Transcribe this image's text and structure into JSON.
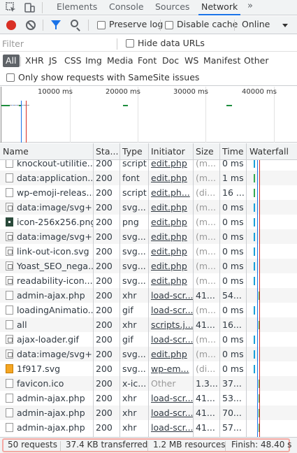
{
  "tabs": {
    "elements": "Elements",
    "console": "Console",
    "sources": "Sources",
    "network": "Network",
    "more": "»"
  },
  "toolbar": {
    "preserve_log": "Preserve log",
    "disable_cache": "Disable cache",
    "throttling": "Online"
  },
  "filter": {
    "placeholder": "Filter",
    "hide_data_urls": "Hide data URLs"
  },
  "types": [
    "All",
    "XHR",
    "JS",
    "CSS",
    "Img",
    "Media",
    "Font",
    "Doc",
    "WS",
    "Manifest",
    "Other"
  ],
  "samesite_label": "Only show requests with SameSite issues",
  "overview": {
    "ticks": [
      "10000 ms",
      "20000 ms",
      "30000 ms",
      "40000 ms"
    ]
  },
  "columns": {
    "name": "Name",
    "status": "Sta...",
    "type": "Type",
    "initiator": "Initiator",
    "size": "Size",
    "time": "Time",
    "waterfall": "Waterfall"
  },
  "rows": [
    {
      "name": "knockout-utilitie...",
      "status": "200",
      "type": "script",
      "initiator": "edit.php",
      "size": "(m...",
      "time": "0 ms",
      "icon": "file"
    },
    {
      "name": "data:application...",
      "status": "200",
      "type": "font",
      "initiator": "edit.php",
      "size": "(m...",
      "time": "1 ms",
      "icon": "file"
    },
    {
      "name": "wp-emoji-releas...",
      "status": "200",
      "type": "script",
      "initiator": "edit.ph...",
      "size": "(di...",
      "time": "16 ...",
      "icon": "file"
    },
    {
      "name": "data:image/svg+...",
      "status": "200",
      "type": "svg...",
      "initiator": "edit.php",
      "size": "(m...",
      "time": "0 ms",
      "icon": "image"
    },
    {
      "name": "icon-256x256.png",
      "status": "200",
      "type": "png",
      "initiator": "edit.php",
      "size": "(m...",
      "time": "0 ms",
      "icon": "dark"
    },
    {
      "name": "data:image/svg+...",
      "status": "200",
      "type": "svg...",
      "initiator": "edit.php",
      "size": "(m...",
      "time": "0 ms",
      "icon": "image"
    },
    {
      "name": "link-out-icon.svg",
      "status": "200",
      "type": "svg...",
      "initiator": "edit.php",
      "size": "(m...",
      "time": "0 ms",
      "icon": "image"
    },
    {
      "name": "Yoast_SEO_nega...",
      "status": "200",
      "type": "svg...",
      "initiator": "edit.php",
      "size": "(m...",
      "time": "0 ms",
      "icon": "image"
    },
    {
      "name": "readability-icon....",
      "status": "200",
      "type": "svg...",
      "initiator": "edit.php",
      "size": "(m...",
      "time": "0 ms",
      "icon": "image"
    },
    {
      "name": "admin-ajax.php",
      "status": "200",
      "type": "xhr",
      "initiator": "load-scr...",
      "size": "41...",
      "time": "54...",
      "icon": "file"
    },
    {
      "name": "loadingAnimatio...",
      "status": "200",
      "type": "gif",
      "initiator": "load-scr...",
      "size": "(m...",
      "time": "0 ms",
      "icon": "file"
    },
    {
      "name": "all",
      "status": "200",
      "type": "xhr",
      "initiator": "scripts.j...",
      "size": "41...",
      "time": "16...",
      "icon": "file"
    },
    {
      "name": "ajax-loader.gif",
      "status": "200",
      "type": "gif",
      "initiator": "load-scr...",
      "size": "(m...",
      "time": "0 ms",
      "icon": "image"
    },
    {
      "name": "data:image/svg+...",
      "status": "200",
      "type": "svg...",
      "initiator": "edit.php",
      "size": "(m...",
      "time": "0 ms",
      "icon": "image"
    },
    {
      "name": "1f917.svg",
      "status": "200",
      "type": "svg...",
      "initiator": "wp-em...",
      "size": "(di...",
      "time": "0 ms",
      "icon": "orange"
    },
    {
      "name": "favicon.ico",
      "status": "200",
      "type": "x-ic...",
      "initiator": "Other",
      "size": "1.3...",
      "time": "37...",
      "icon": "file"
    },
    {
      "name": "admin-ajax.php",
      "status": "200",
      "type": "xhr",
      "initiator": "load-scr...",
      "size": "41...",
      "time": "53...",
      "icon": "file"
    },
    {
      "name": "admin-ajax.php",
      "status": "200",
      "type": "xhr",
      "initiator": "load-scr...",
      "size": "41...",
      "time": "70...",
      "icon": "file"
    },
    {
      "name": "admin-ajax.php",
      "status": "200",
      "type": "xhr",
      "initiator": "load-scr...",
      "size": "41...",
      "time": "57...",
      "icon": "file"
    }
  ],
  "statusbar": {
    "requests": "50 requests",
    "transferred": "37.4 KB transferred",
    "resources": "1.2 MB resources",
    "finish": "Finish: 48.40 s"
  },
  "colors": {
    "accent": "#1a73e8",
    "record": "#d93025",
    "highlight": "#f4a8a3"
  }
}
